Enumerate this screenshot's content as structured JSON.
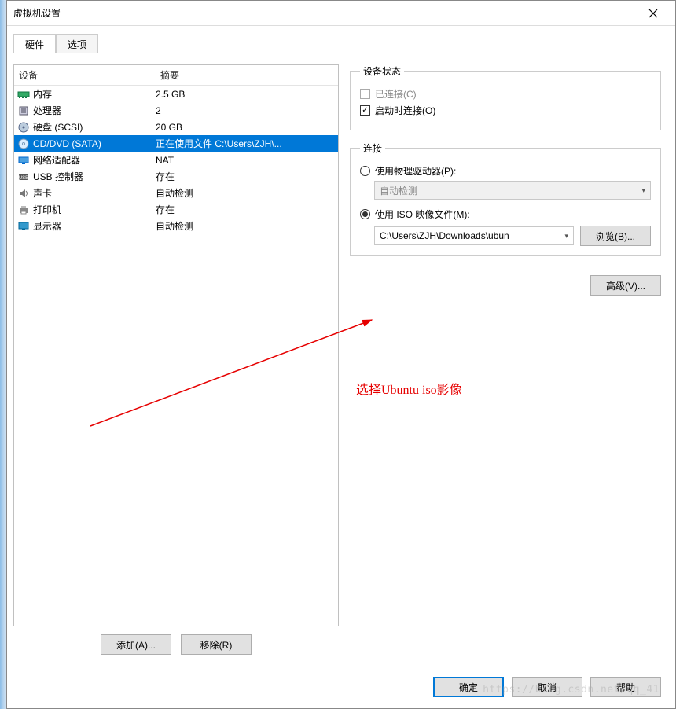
{
  "window": {
    "title": "虚拟机设置"
  },
  "tabs": {
    "hardware": "硬件",
    "options": "选项"
  },
  "device_list": {
    "headers": {
      "device": "设备",
      "summary": "摘要"
    },
    "rows": [
      {
        "icon": "memory-icon",
        "name": "内存",
        "summary": "2.5 GB",
        "selected": false
      },
      {
        "icon": "cpu-icon",
        "name": "处理器",
        "summary": "2",
        "selected": false
      },
      {
        "icon": "hdd-icon",
        "name": "硬盘 (SCSI)",
        "summary": "20 GB",
        "selected": false
      },
      {
        "icon": "cd-icon",
        "name": "CD/DVD (SATA)",
        "summary": "正在使用文件 C:\\Users\\ZJH\\...",
        "selected": true
      },
      {
        "icon": "network-icon",
        "name": "网络适配器",
        "summary": "NAT",
        "selected": false
      },
      {
        "icon": "usb-icon",
        "name": "USB 控制器",
        "summary": "存在",
        "selected": false
      },
      {
        "icon": "sound-icon",
        "name": "声卡",
        "summary": "自动检测",
        "selected": false
      },
      {
        "icon": "printer-icon",
        "name": "打印机",
        "summary": "存在",
        "selected": false
      },
      {
        "icon": "display-icon",
        "name": "显示器",
        "summary": "自动检测",
        "selected": false
      }
    ]
  },
  "buttons": {
    "add": "添加(A)...",
    "remove": "移除(R)",
    "browse": "浏览(B)...",
    "advanced": "高级(V)...",
    "ok": "确定",
    "cancel": "取消",
    "help": "帮助"
  },
  "device_status": {
    "legend": "设备状态",
    "connected": {
      "label": "已连接(C)",
      "checked": false,
      "enabled": false
    },
    "connect_at_poweron": {
      "label": "启动时连接(O)",
      "checked": true,
      "enabled": true
    }
  },
  "connection": {
    "legend": "连接",
    "physical": {
      "label": "使用物理驱动器(P):",
      "selected": false,
      "dropdown": "自动检测"
    },
    "iso": {
      "label": "使用 ISO 映像文件(M):",
      "selected": true,
      "path": "C:\\Users\\ZJH\\Downloads\\ubun"
    }
  },
  "annotation": "选择Ubuntu iso影像",
  "watermark": "https://blog.csdn.net/qq_41"
}
